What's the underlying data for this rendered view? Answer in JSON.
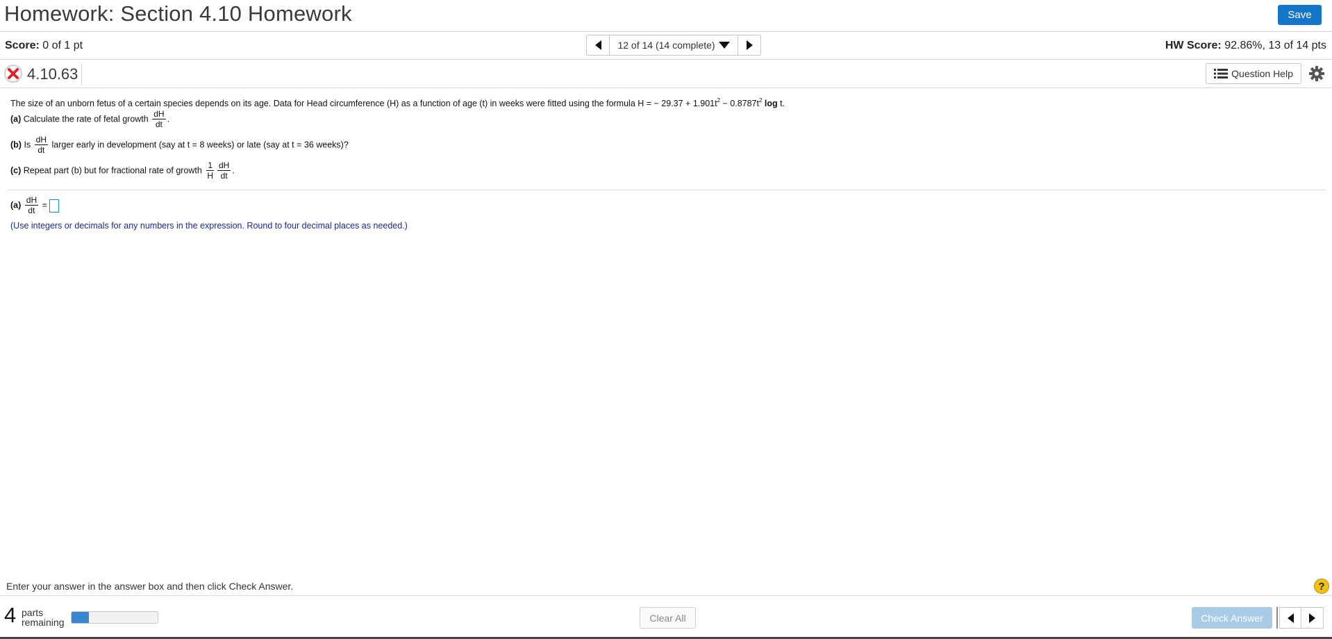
{
  "header": {
    "title": "Homework: Section 4.10 Homework",
    "save_label": "Save"
  },
  "scorebar": {
    "score_label": "Score:",
    "score_value": "0 of 1 pt",
    "question_selector": "12 of 14 (14 complete)",
    "hw_score_label": "HW Score:",
    "hw_score_value": "92.86%, 13 of 14 pts"
  },
  "question": {
    "id": "4.10.63",
    "help_label": "Question Help",
    "status": "incorrect",
    "intro": "The size of an unborn fetus of a certain species depends on its age. Data for Head circumference (H) as a function of age (t) in weeks were fitted using the formula H = − 29.37 + 1.901t",
    "formula_exp1": "2",
    "formula_mid": " − 0.8787t",
    "formula_exp2": "2",
    "formula_log": "log",
    "formula_end": " t.",
    "part_a_label": "(a)",
    "part_a_text": "Calculate the rate of fetal growth",
    "part_b_label": "(b)",
    "part_b_pre": "Is",
    "part_b_post": "larger early in development (say at t = 8 weeks) or late (say at t = 36 weeks)?",
    "part_c_label": "(c)",
    "part_c_text": "Repeat part (b) but for fractional rate of growth",
    "frac_dH": "dH",
    "frac_dt": "dt",
    "frac_1": "1",
    "frac_H": "H",
    "period": "."
  },
  "answer": {
    "label": "(a)",
    "equals": "=",
    "value": "",
    "hint": "(Use integers or decimals for any numbers in the expression. Round to four decimal places as needed.)"
  },
  "footer": {
    "instruction": "Enter your answer in the answer box and then click Check Answer.",
    "help_icon": "?",
    "parts_count": "4",
    "parts_label_1": "parts",
    "parts_label_2": "remaining",
    "progress_fraction": 0.2,
    "clear_all_label": "Clear All",
    "check_answer_label": "Check Answer"
  },
  "icons": {
    "status": "x-circle-icon",
    "nav_prev": "triangle-left-icon",
    "nav_next": "triangle-right-icon",
    "dropdown": "triangle-down-icon",
    "help": "list-icon",
    "settings": "gear-icon"
  },
  "colors": {
    "accent": "#1475c9",
    "error": "#d9232d",
    "hint_text": "#1b2a8f",
    "check_answer_disabled": "#a9cbe6"
  }
}
